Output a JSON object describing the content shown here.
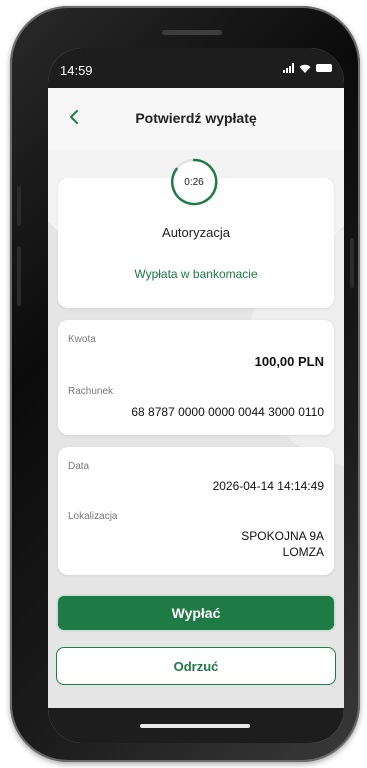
{
  "status_bar": {
    "time": "14:59"
  },
  "header": {
    "title": "Potwierdź wypłatę"
  },
  "authorization": {
    "timer": "0:26",
    "title": "Autoryzacja",
    "subtitle": "Wypłata w bankomacie"
  },
  "amount_card": {
    "amount_label": "Kwota",
    "amount_value": "100,00 PLN",
    "account_label": "Rachunek",
    "account_value": "68 8787 0000 0000 0044 3000 0110"
  },
  "details_card": {
    "date_label": "Data",
    "date_value": "2026-04-14 14:14:49",
    "location_label": "Lokalizacja",
    "location_line1": "SPOKOJNA 9A",
    "location_line2": "LOMZA"
  },
  "buttons": {
    "confirm": "Wypłać",
    "reject": "Odrzuć"
  },
  "colors": {
    "accent": "#1e7b45",
    "background": "#e5e5e5"
  },
  "icons": {
    "back": "chevron-left-icon",
    "signal": "signal-icon",
    "wifi": "wifi-icon",
    "battery": "battery-icon"
  }
}
